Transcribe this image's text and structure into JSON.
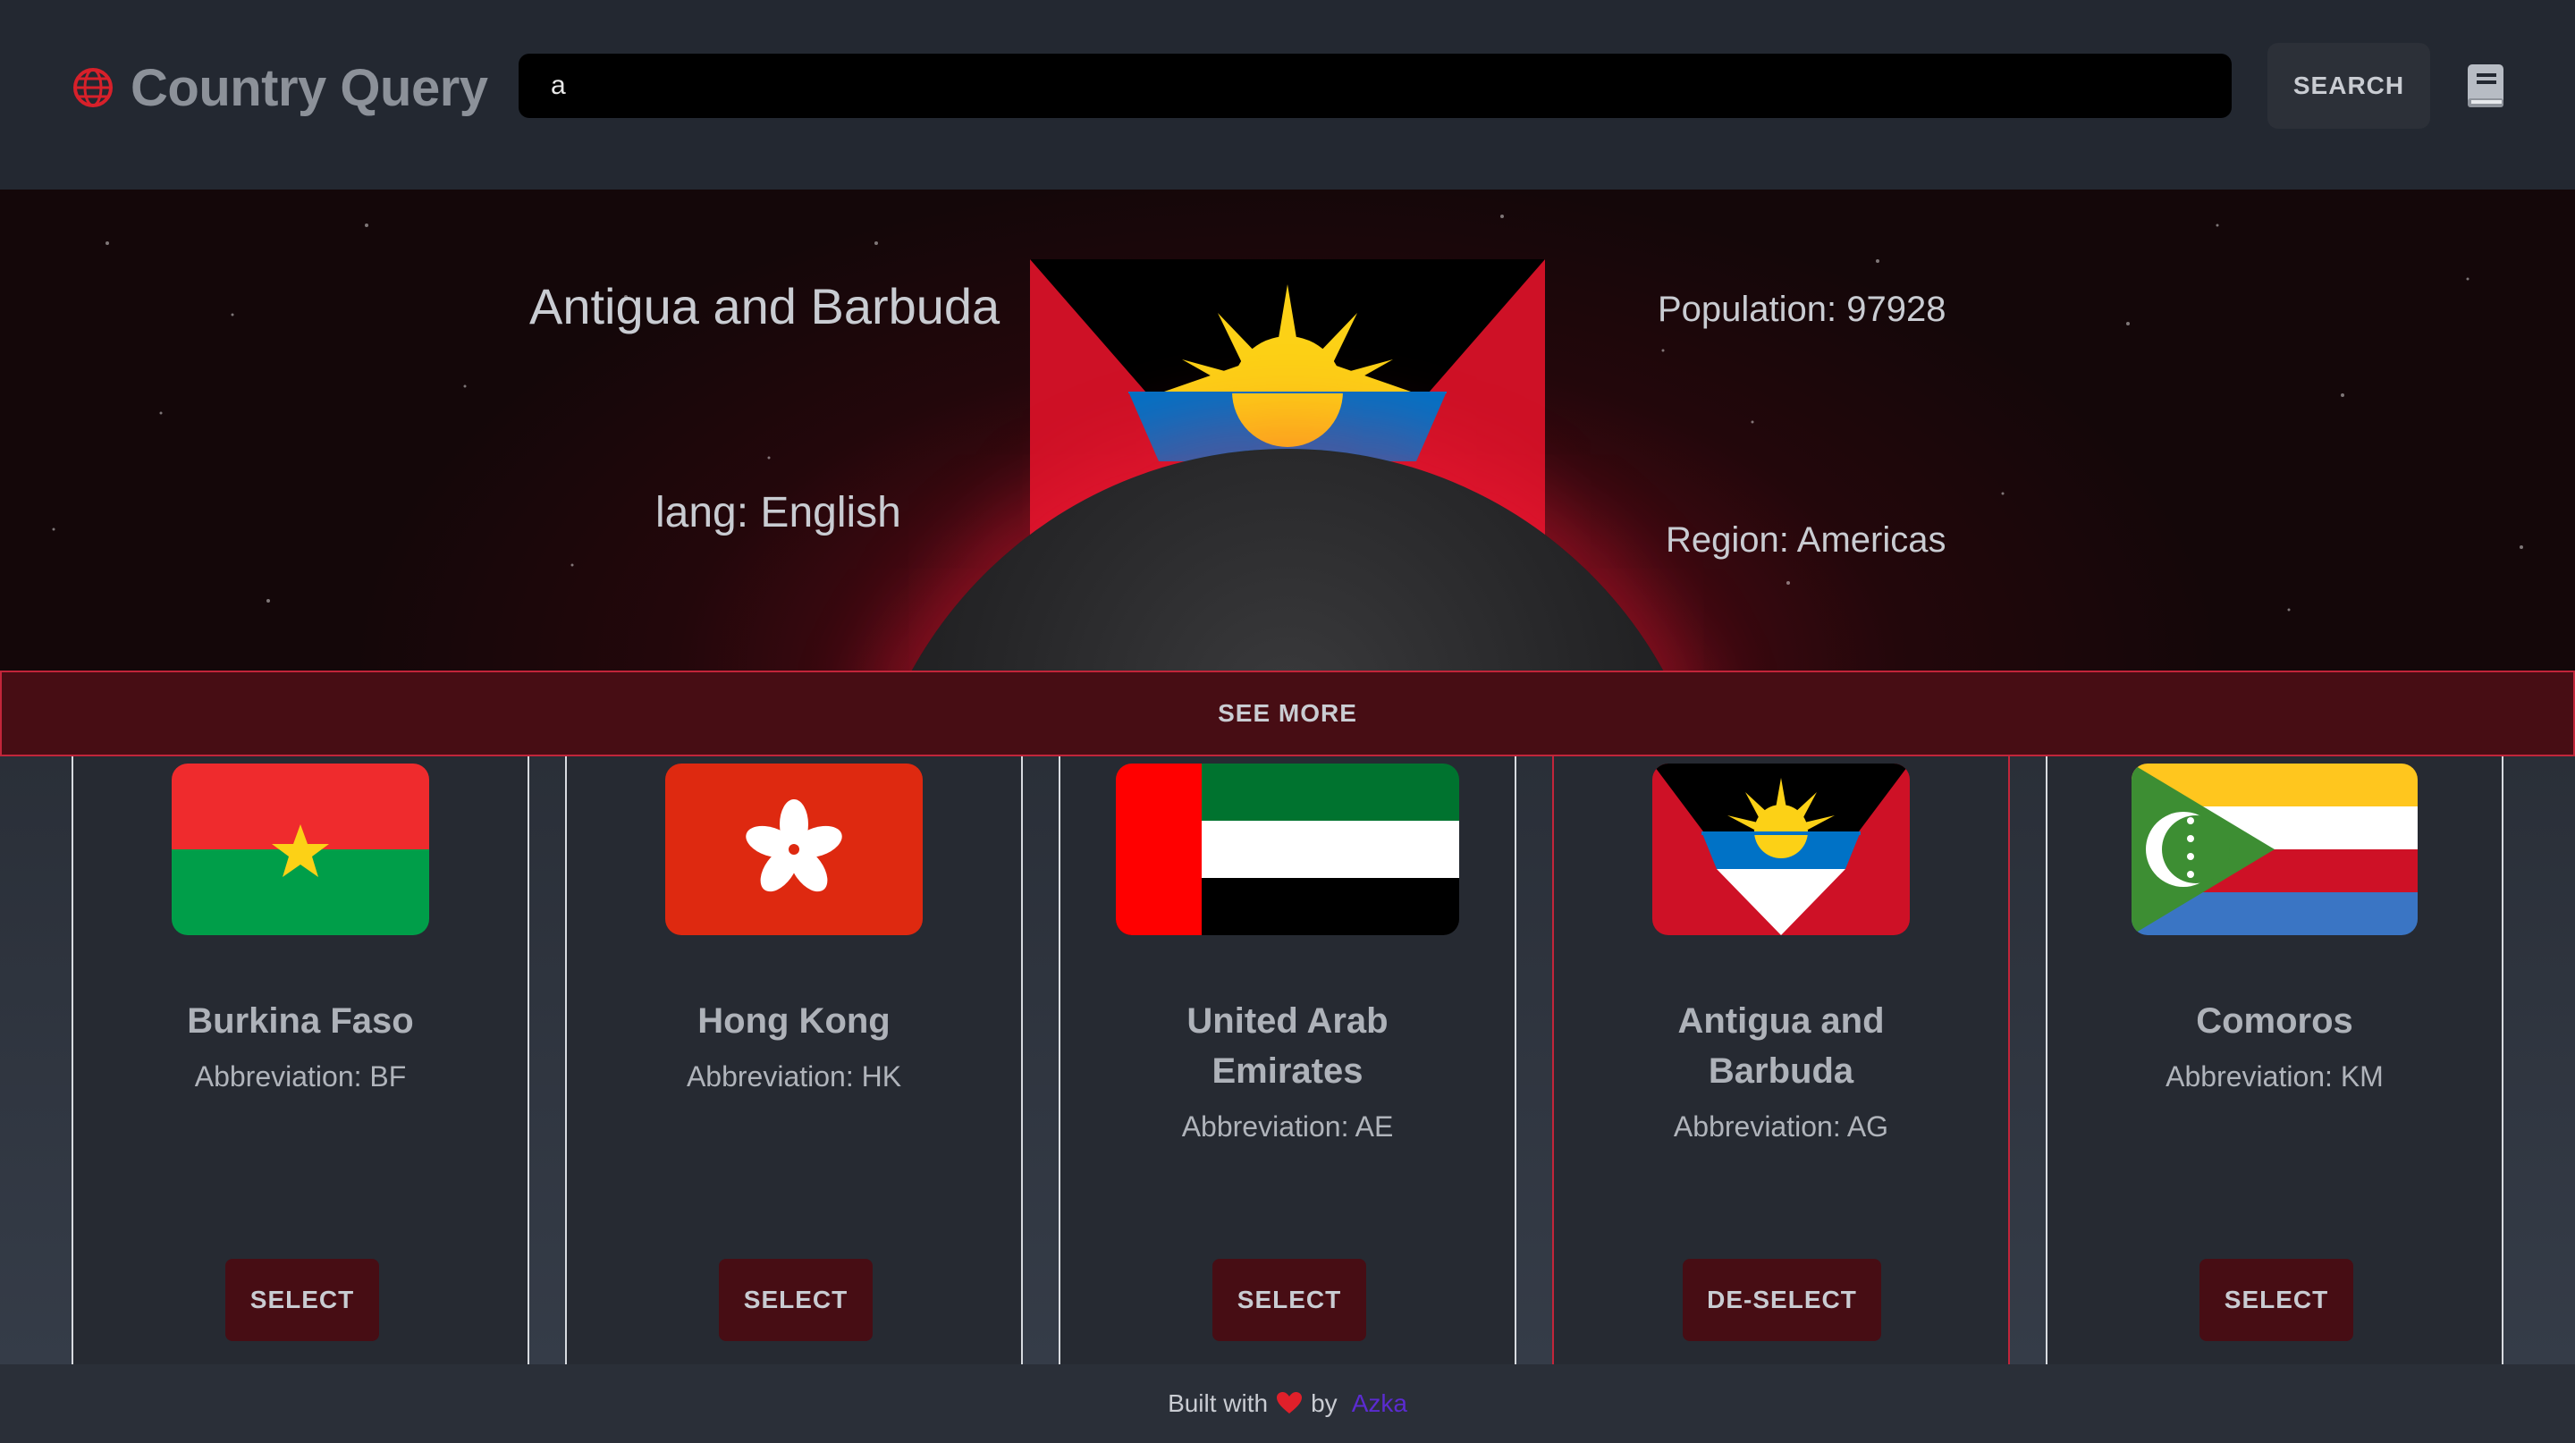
{
  "header": {
    "title": "Country Query",
    "search_value": "a",
    "search_button": "SEARCH",
    "icons": {
      "brand": "globe-icon",
      "docs": "book-icon"
    }
  },
  "hero": {
    "country_name": "Antigua and Barbuda",
    "lang": "lang: English",
    "population": "Population: 97928",
    "region": "Region: Americas",
    "see_more": "SEE MORE"
  },
  "cards": [
    {
      "name": "Burkina Faso",
      "abbr": "Abbreviation: BF",
      "button": "SELECT",
      "selected": false
    },
    {
      "name": "Hong Kong",
      "abbr": "Abbreviation: HK",
      "button": "SELECT",
      "selected": false
    },
    {
      "name": "United Arab Emirates",
      "abbr": "Abbreviation: AE",
      "button": "SELECT",
      "selected": false
    },
    {
      "name": "Antigua and Barbuda",
      "abbr": "Abbreviation: AG",
      "button": "DE-SELECT",
      "selected": true
    },
    {
      "name": "Comoros",
      "abbr": "Abbreviation: KM",
      "button": "SELECT",
      "selected": false
    }
  ],
  "footer": {
    "built_with": "Built with",
    "by": "by",
    "author": "Azka"
  },
  "colors": {
    "accent_red": "#c2253a",
    "button_dark_red": "#470d14",
    "author_link": "#5b2bd1"
  }
}
